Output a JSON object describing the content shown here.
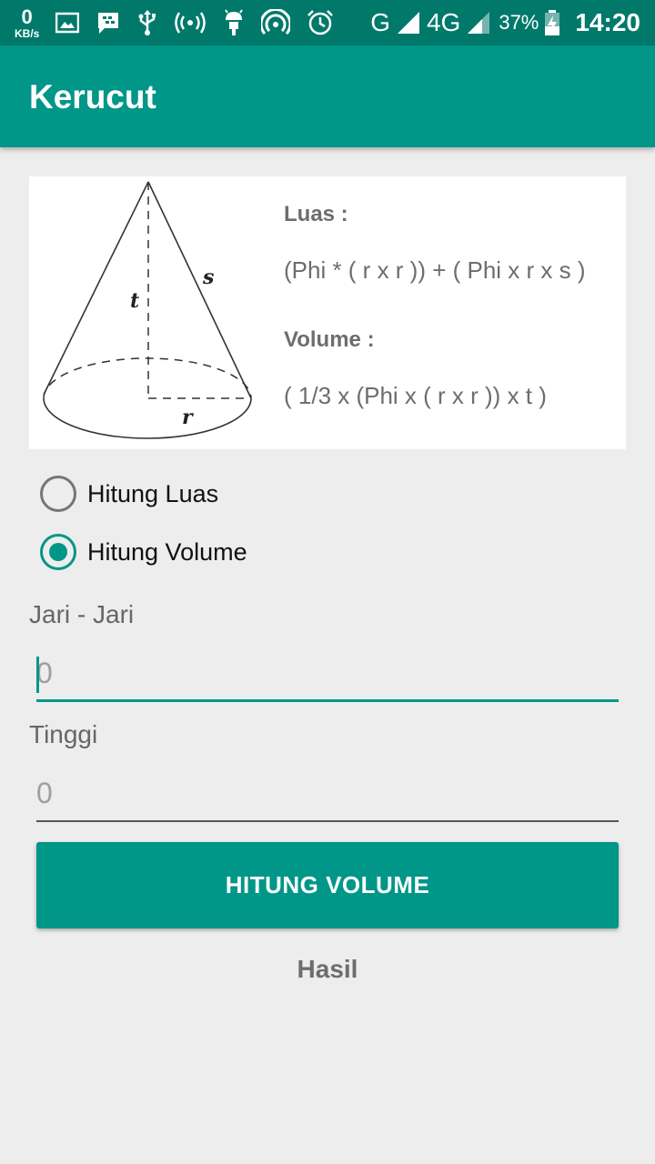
{
  "status_bar": {
    "net_speed_value": "0",
    "net_speed_unit": "KB/s",
    "network_g": "G",
    "network_4g": "4G",
    "network_4g_small": "4G",
    "battery_percent": "37%",
    "time": "14:20",
    "icons": [
      "image-icon",
      "bbm-icon",
      "usb-icon",
      "hotspot-icon",
      "android-icon",
      "wireless-icon",
      "alarm-icon",
      "signal-icon",
      "signal-icon",
      "battery-charging-icon"
    ]
  },
  "app_bar": {
    "title": "Kerucut"
  },
  "formula_card": {
    "cone_labels": {
      "height": "t",
      "slant": "s",
      "radius": "r"
    },
    "luas_label": "Luas :",
    "luas_formula": "(Phi * ( r x r )) + ( Phi x r x s )",
    "volume_label": "Volume :",
    "volume_formula": "( 1/3 x (Phi x ( r x r )) x t )"
  },
  "options": {
    "items": [
      {
        "label": "Hitung Luas",
        "checked": false
      },
      {
        "label": "Hitung Volume",
        "checked": true
      }
    ]
  },
  "form": {
    "radius_label": "Jari - Jari",
    "radius_value": "",
    "radius_placeholder": "0",
    "height_label": "Tinggi",
    "height_value": "",
    "height_placeholder": "0"
  },
  "action_button": {
    "label": "HITUNG VOLUME"
  },
  "result": {
    "text": "Hasil"
  },
  "colors": {
    "primary": "#009688",
    "primary_dark": "#00796b",
    "background": "#ededed",
    "secondary_text": "#6d6d6d"
  }
}
